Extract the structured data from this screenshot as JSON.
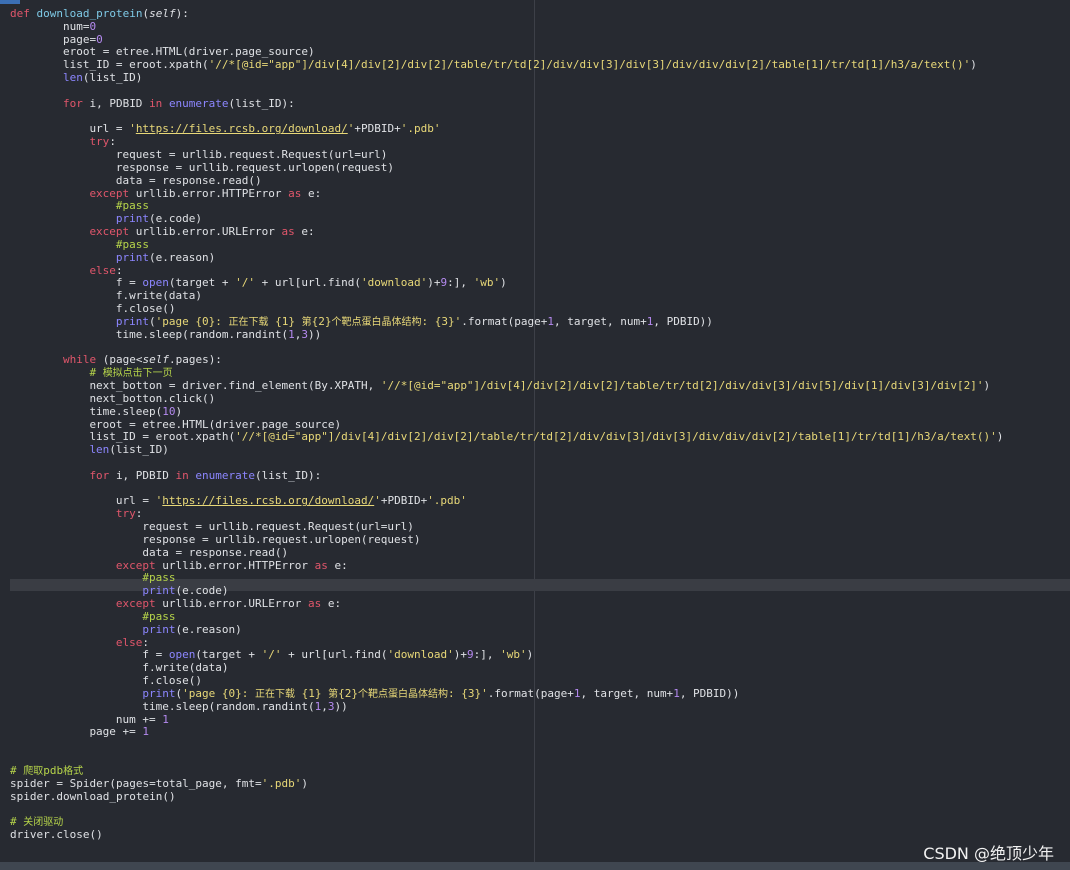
{
  "editor": {
    "lines": [
      {
        "indent": 0,
        "tokens": [
          [
            "kw",
            "def "
          ],
          [
            "fn",
            "download_protein"
          ],
          [
            "p",
            "("
          ],
          [
            "it",
            "self"
          ],
          [
            "p",
            "):"
          ]
        ]
      },
      {
        "indent": 8,
        "tokens": [
          [
            "p",
            "num="
          ],
          [
            "num",
            "0"
          ]
        ]
      },
      {
        "indent": 8,
        "tokens": [
          [
            "p",
            "page="
          ],
          [
            "num",
            "0"
          ]
        ]
      },
      {
        "indent": 8,
        "tokens": [
          [
            "p",
            "eroot = etree.HTML(driver.page_source)"
          ]
        ]
      },
      {
        "indent": 8,
        "tokens": [
          [
            "p",
            "list_ID = eroot.xpath("
          ],
          [
            "str",
            "'//*[@id=\"app\"]/div[4]/div[2]/div[2]/table/tr/td[2]/div/div[3]/div[3]/div/div/div[2]/table[1]/tr/td[1]/h3/a/text()'"
          ],
          [
            "p",
            ")"
          ]
        ]
      },
      {
        "indent": 8,
        "tokens": [
          [
            "bi",
            "len"
          ],
          [
            "p",
            "(list_ID)"
          ]
        ]
      },
      {
        "indent": 0,
        "tokens": []
      },
      {
        "indent": 8,
        "tokens": [
          [
            "kw",
            "for "
          ],
          [
            "p",
            "i, PDBID "
          ],
          [
            "kw",
            "in "
          ],
          [
            "bi",
            "enumerate"
          ],
          [
            "p",
            "(list_ID):"
          ]
        ]
      },
      {
        "indent": 0,
        "tokens": []
      },
      {
        "indent": 12,
        "tokens": [
          [
            "p",
            "url = "
          ],
          [
            "str",
            "'"
          ],
          [
            "url",
            "https://files.rcsb.org/download/"
          ],
          [
            "str",
            "'"
          ],
          [
            "p",
            "+PDBID+"
          ],
          [
            "str",
            "'.pdb'"
          ]
        ]
      },
      {
        "indent": 12,
        "tokens": [
          [
            "kw",
            "try"
          ],
          [
            "p",
            ":"
          ]
        ]
      },
      {
        "indent": 16,
        "tokens": [
          [
            "p",
            "request = urllib.request.Request(url=url)"
          ]
        ]
      },
      {
        "indent": 16,
        "tokens": [
          [
            "p",
            "response = urllib.request.urlopen(request)"
          ]
        ]
      },
      {
        "indent": 16,
        "tokens": [
          [
            "p",
            "data = response.read()"
          ]
        ]
      },
      {
        "indent": 12,
        "tokens": [
          [
            "kw",
            "except "
          ],
          [
            "p",
            "urllib.error.HTTPError "
          ],
          [
            "kw",
            "as "
          ],
          [
            "p",
            "e:"
          ]
        ]
      },
      {
        "indent": 16,
        "tokens": [
          [
            "cm",
            "#pass"
          ]
        ]
      },
      {
        "indent": 16,
        "tokens": [
          [
            "bi",
            "print"
          ],
          [
            "p",
            "(e.code)"
          ]
        ]
      },
      {
        "indent": 12,
        "tokens": [
          [
            "kw",
            "except "
          ],
          [
            "p",
            "urllib.error.URLError "
          ],
          [
            "kw",
            "as "
          ],
          [
            "p",
            "e:"
          ]
        ]
      },
      {
        "indent": 16,
        "tokens": [
          [
            "cm",
            "#pass"
          ]
        ]
      },
      {
        "indent": 16,
        "tokens": [
          [
            "bi",
            "print"
          ],
          [
            "p",
            "(e.reason)"
          ]
        ]
      },
      {
        "indent": 12,
        "tokens": [
          [
            "kw",
            "else"
          ],
          [
            "p",
            ":"
          ]
        ]
      },
      {
        "indent": 16,
        "tokens": [
          [
            "p",
            "f = "
          ],
          [
            "bi",
            "open"
          ],
          [
            "p",
            "(target + "
          ],
          [
            "str",
            "'/'"
          ],
          [
            "p",
            " + url[url.find("
          ],
          [
            "str",
            "'download'"
          ],
          [
            "p",
            ")+"
          ],
          [
            "num",
            "9"
          ],
          [
            "p",
            ":], "
          ],
          [
            "str",
            "'wb'"
          ],
          [
            "p",
            ")"
          ]
        ]
      },
      {
        "indent": 16,
        "tokens": [
          [
            "p",
            "f.write(data)"
          ]
        ]
      },
      {
        "indent": 16,
        "tokens": [
          [
            "p",
            "f.close()"
          ]
        ]
      },
      {
        "indent": 16,
        "tokens": [
          [
            "bi",
            "print"
          ],
          [
            "p",
            "("
          ],
          [
            "str",
            "'page {0}: "
          ],
          [
            "strcn",
            "正在下载"
          ],
          [
            "str",
            " {1} "
          ],
          [
            "strcn",
            "第"
          ],
          [
            "str",
            "{2}"
          ],
          [
            "strcn",
            "个靶点蛋白晶体结构"
          ],
          [
            "str",
            ": {3}'"
          ],
          [
            "p",
            ".format(page+"
          ],
          [
            "num",
            "1"
          ],
          [
            "p",
            ", target, num+"
          ],
          [
            "num",
            "1"
          ],
          [
            "p",
            ", PDBID))"
          ]
        ]
      },
      {
        "indent": 16,
        "tokens": [
          [
            "p",
            "time.sleep(random.randint("
          ],
          [
            "num",
            "1"
          ],
          [
            "p",
            ","
          ],
          [
            "num",
            "3"
          ],
          [
            "p",
            "))"
          ]
        ]
      },
      {
        "indent": 0,
        "tokens": []
      },
      {
        "indent": 8,
        "tokens": [
          [
            "kw",
            "while "
          ],
          [
            "p",
            "(page<"
          ],
          [
            "it",
            "self"
          ],
          [
            "p",
            ".pages):"
          ]
        ]
      },
      {
        "indent": 12,
        "tokens": [
          [
            "cm",
            "# "
          ],
          [
            "cmcn",
            "模拟点击下一页"
          ]
        ]
      },
      {
        "indent": 12,
        "tokens": [
          [
            "p",
            "next_botton = driver.find_element(By.XPATH, "
          ],
          [
            "str",
            "'//*[@id=\"app\"]/div[4]/div[2]/div[2]/table/tr/td[2]/div/div[3]/div[5]/div[1]/div[3]/div[2]'"
          ],
          [
            "p",
            ")"
          ]
        ]
      },
      {
        "indent": 12,
        "tokens": [
          [
            "p",
            "next_botton.click()"
          ]
        ]
      },
      {
        "indent": 12,
        "tokens": [
          [
            "p",
            "time.sleep("
          ],
          [
            "num",
            "10"
          ],
          [
            "p",
            ")"
          ]
        ]
      },
      {
        "indent": 12,
        "tokens": [
          [
            "p",
            "eroot = etree.HTML(driver.page_source)"
          ]
        ]
      },
      {
        "indent": 12,
        "tokens": [
          [
            "p",
            "list_ID = eroot.xpath("
          ],
          [
            "str",
            "'//*[@id=\"app\"]/div[4]/div[2]/div[2]/table/tr/td[2]/div/div[3]/div[3]/div/div/div[2]/table[1]/tr/td[1]/h3/a/text()'"
          ],
          [
            "p",
            ")"
          ]
        ]
      },
      {
        "indent": 12,
        "tokens": [
          [
            "bi",
            "len"
          ],
          [
            "p",
            "(list_ID)"
          ]
        ]
      },
      {
        "indent": 0,
        "tokens": []
      },
      {
        "indent": 12,
        "tokens": [
          [
            "kw",
            "for "
          ],
          [
            "p",
            "i, PDBID "
          ],
          [
            "kw",
            "in "
          ],
          [
            "bi",
            "enumerate"
          ],
          [
            "p",
            "(list_ID):"
          ]
        ]
      },
      {
        "indent": 0,
        "tokens": []
      },
      {
        "indent": 16,
        "tokens": [
          [
            "p",
            "url = "
          ],
          [
            "str",
            "'"
          ],
          [
            "url",
            "https://files.rcsb.org/download/"
          ],
          [
            "str",
            "'"
          ],
          [
            "p",
            "+PDBID+"
          ],
          [
            "str",
            "'.pdb'"
          ]
        ]
      },
      {
        "indent": 16,
        "tokens": [
          [
            "kw",
            "try"
          ],
          [
            "p",
            ":"
          ]
        ]
      },
      {
        "indent": 20,
        "tokens": [
          [
            "p",
            "request = urllib.request.Request(url=url)"
          ]
        ]
      },
      {
        "indent": 20,
        "tokens": [
          [
            "p",
            "response = urllib.request.urlopen(request)"
          ]
        ]
      },
      {
        "indent": 20,
        "tokens": [
          [
            "p",
            "data = response.read()"
          ]
        ]
      },
      {
        "indent": 16,
        "tokens": [
          [
            "kw",
            "except "
          ],
          [
            "p",
            "urllib.error.HTTPError "
          ],
          [
            "kw",
            "as "
          ],
          [
            "p",
            "e:"
          ]
        ]
      },
      {
        "indent": 20,
        "tokens": [
          [
            "cm",
            "#pass"
          ]
        ]
      },
      {
        "indent": 20,
        "tokens": [
          [
            "bi",
            "print"
          ],
          [
            "p",
            "(e.code)"
          ]
        ]
      },
      {
        "indent": 16,
        "tokens": [
          [
            "kw",
            "except "
          ],
          [
            "p",
            "urllib.error.URLError "
          ],
          [
            "kw",
            "as "
          ],
          [
            "p",
            "e:"
          ]
        ]
      },
      {
        "indent": 20,
        "tokens": [
          [
            "cm",
            "#pass"
          ]
        ]
      },
      {
        "indent": 20,
        "tokens": [
          [
            "bi",
            "print"
          ],
          [
            "p",
            "(e.reason)"
          ]
        ]
      },
      {
        "indent": 16,
        "tokens": [
          [
            "kw",
            "else"
          ],
          [
            "p",
            ":"
          ]
        ]
      },
      {
        "indent": 20,
        "tokens": [
          [
            "p",
            "f = "
          ],
          [
            "bi",
            "open"
          ],
          [
            "p",
            "(target + "
          ],
          [
            "str",
            "'/'"
          ],
          [
            "p",
            " + url[url.find("
          ],
          [
            "str",
            "'download'"
          ],
          [
            "p",
            ")+"
          ],
          [
            "num",
            "9"
          ],
          [
            "p",
            ":], "
          ],
          [
            "str",
            "'wb'"
          ],
          [
            "p",
            ")"
          ]
        ]
      },
      {
        "indent": 20,
        "tokens": [
          [
            "p",
            "f.write(data)"
          ]
        ]
      },
      {
        "indent": 20,
        "tokens": [
          [
            "p",
            "f.close()"
          ]
        ]
      },
      {
        "indent": 20,
        "tokens": [
          [
            "bi",
            "print"
          ],
          [
            "p",
            "("
          ],
          [
            "str",
            "'page {0}: "
          ],
          [
            "strcn",
            "正在下载"
          ],
          [
            "str",
            " {1} "
          ],
          [
            "strcn",
            "第"
          ],
          [
            "str",
            "{2}"
          ],
          [
            "strcn",
            "个靶点蛋白晶体结构"
          ],
          [
            "str",
            ": {3}'"
          ],
          [
            "p",
            ".format(page+"
          ],
          [
            "num",
            "1"
          ],
          [
            "p",
            ", target, num+"
          ],
          [
            "num",
            "1"
          ],
          [
            "p",
            ", PDBID))"
          ]
        ]
      },
      {
        "indent": 20,
        "tokens": [
          [
            "p",
            "time.sleep(random.randint("
          ],
          [
            "num",
            "1"
          ],
          [
            "p",
            ","
          ],
          [
            "num",
            "3"
          ],
          [
            "p",
            "))"
          ]
        ]
      },
      {
        "indent": 16,
        "tokens": [
          [
            "p",
            "num += "
          ],
          [
            "num",
            "1"
          ]
        ]
      },
      {
        "indent": 12,
        "tokens": [
          [
            "p",
            "page += "
          ],
          [
            "num",
            "1"
          ]
        ]
      },
      {
        "indent": 0,
        "tokens": []
      },
      {
        "indent": 0,
        "tokens": []
      },
      {
        "indent": 0,
        "tokens": [
          [
            "cm",
            "# "
          ],
          [
            "cmcn",
            "爬取"
          ],
          [
            "cm",
            "pdb"
          ],
          [
            "cmcn",
            "格式"
          ]
        ]
      },
      {
        "indent": 0,
        "tokens": [
          [
            "p",
            "spider = Spider(pages=total_page, fmt="
          ],
          [
            "str",
            "'.pdb'"
          ],
          [
            "p",
            ")"
          ]
        ]
      },
      {
        "indent": 0,
        "tokens": [
          [
            "p",
            "spider.download_protein()"
          ]
        ]
      },
      {
        "indent": 0,
        "tokens": []
      },
      {
        "indent": 0,
        "tokens": [
          [
            "cm",
            "# "
          ],
          [
            "cmcn",
            "关闭驱动"
          ]
        ]
      },
      {
        "indent": 0,
        "tokens": [
          [
            "p",
            "driver.close()"
          ]
        ]
      }
    ]
  },
  "watermark": "CSDN @绝顶少年",
  "colors": {
    "background": "#272a31",
    "keyword": "#e0566b",
    "function": "#7ec9e6",
    "string": "#e8d878",
    "number": "#b58af0",
    "comment": "#b6d44a",
    "builtin": "#8c86ff"
  }
}
